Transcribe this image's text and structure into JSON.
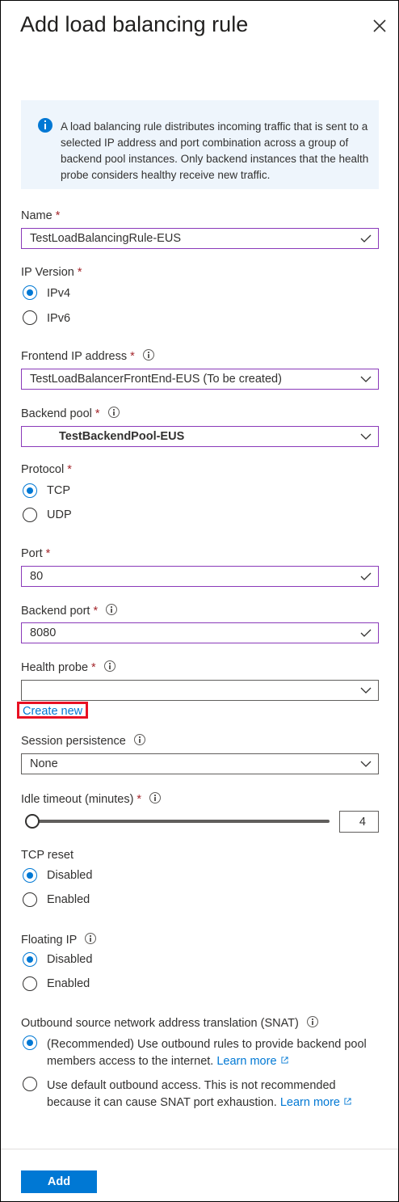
{
  "title": "Add load balancing rule",
  "info_text": "A load balancing rule distributes incoming traffic that is sent to a selected IP address and port combination across a group of backend pool instances. Only backend instances that the health probe considers healthy receive new traffic.",
  "required_mark": "*",
  "name": {
    "label": "Name",
    "value": "TestLoadBalancingRule-EUS"
  },
  "ip_version": {
    "label": "IP Version",
    "options": [
      "IPv4",
      "IPv6"
    ],
    "selected": "IPv4"
  },
  "frontend_ip": {
    "label": "Frontend IP address",
    "value": "TestLoadBalancerFrontEnd-EUS (To be created)"
  },
  "backend_pool": {
    "label": "Backend pool",
    "value": "TestBackendPool-EUS"
  },
  "protocol": {
    "label": "Protocol",
    "options": [
      "TCP",
      "UDP"
    ],
    "selected": "TCP"
  },
  "port": {
    "label": "Port",
    "value": "80"
  },
  "backend_port": {
    "label": "Backend port",
    "value": "8080"
  },
  "health_probe": {
    "label": "Health probe",
    "value": "",
    "create_new": "Create new"
  },
  "session_persistence": {
    "label": "Session persistence",
    "value": "None"
  },
  "idle_timeout": {
    "label": "Idle timeout (minutes)",
    "value": "4",
    "slider_level": 4
  },
  "tcp_reset": {
    "label": "TCP reset",
    "options": [
      "Disabled",
      "Enabled"
    ],
    "selected": "Disabled"
  },
  "floating_ip": {
    "label": "Floating IP",
    "options": [
      "Disabled",
      "Enabled"
    ],
    "selected": "Disabled"
  },
  "snat": {
    "label": "Outbound source network address translation (SNAT)",
    "option1_text": "(Recommended) Use outbound rules to provide backend pool members access to the internet.",
    "option2_text": "Use default outbound access. This is not recommended because it can cause SNAT port exhaustion.",
    "learn_more": "Learn more",
    "selected": 1
  },
  "add_button": "Add",
  "colors": {
    "accent": "#0078d4",
    "valid_border": "#8a3ab9",
    "required": "#a4262c",
    "highlight": "#e81123"
  }
}
